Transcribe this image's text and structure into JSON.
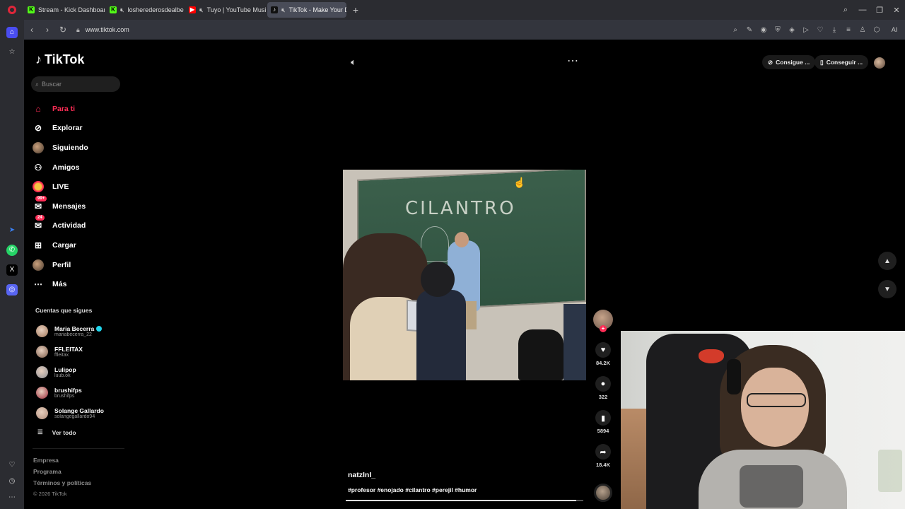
{
  "browser": {
    "tabs": [
      {
        "label": "Stream - Kick Dashboard",
        "fav_color": "#53fc18",
        "fav_glyph": "K",
        "muted": false,
        "active": false
      },
      {
        "label": "losherederosdealberdi",
        "fav_color": "#53fc18",
        "fav_glyph": "K",
        "muted": true,
        "active": false
      },
      {
        "label": "Tuyo | YouTube Music",
        "fav_color": "#ff0000",
        "fav_glyph": "▶",
        "muted": true,
        "active": false
      },
      {
        "label": "TikTok - Make Your Da",
        "fav_color": "#111111",
        "fav_glyph": "♪",
        "muted": true,
        "active": true
      }
    ],
    "url": "www.tiktok.com",
    "ai_label": "AI"
  },
  "tiktok": {
    "logo_text": "TikTok",
    "search_placeholder": "Buscar",
    "menu": [
      {
        "label": "Para ti",
        "icon": "home-icon",
        "active": true
      },
      {
        "label": "Explorar",
        "icon": "compass-icon",
        "active": false
      },
      {
        "label": "Siguiendo",
        "icon": "following-avatar",
        "active": false
      },
      {
        "label": "Amigos",
        "icon": "friends-icon",
        "active": false
      },
      {
        "label": "LIVE",
        "icon": "live-icon",
        "active": false
      },
      {
        "label": "Mensajes",
        "icon": "messages-icon",
        "active": false,
        "badge": "99+"
      },
      {
        "label": "Actividad",
        "icon": "activity-icon",
        "active": false,
        "badge": "24"
      },
      {
        "label": "Cargar",
        "icon": "upload-icon",
        "active": false
      },
      {
        "label": "Perfil",
        "icon": "profile-avatar",
        "active": false
      },
      {
        "label": "Más",
        "icon": "more-icon",
        "active": false
      }
    ],
    "following_title": "Cuentas que sigues",
    "following": [
      {
        "name": "Maria Becerra",
        "handle": "mariabecerra_22",
        "verified": true,
        "color": "#a0765a"
      },
      {
        "name": "FFLEITAX",
        "handle": "ffleitax",
        "verified": false,
        "color": "#7a5a48"
      },
      {
        "name": "Lulipop",
        "handle": "luub.ok",
        "verified": false,
        "color": "#8c8f95"
      },
      {
        "name": "brushifps",
        "handle": "brushifps",
        "verified": false,
        "color": "#9b2a3a"
      },
      {
        "name": "Solange Gallardo",
        "handle": "solangegallardo94",
        "verified": false,
        "color": "#b08c7a"
      }
    ],
    "see_all": "Ver todo",
    "footer": [
      "Empresa",
      "Programa",
      "Términos y políticas"
    ],
    "copyright": "© 2026 TikTok",
    "top_pills": [
      "Consigue ...",
      "Conseguir ..."
    ],
    "video": {
      "board_text": "CILANTRO",
      "author": "natzInI_",
      "tags": "#profesor #enojado #cilantro #perejil #humor",
      "progress": 0.97
    },
    "actions": [
      {
        "icon": "heart-icon",
        "count": "84.2K"
      },
      {
        "icon": "comment-icon",
        "count": "322"
      },
      {
        "icon": "bookmark-icon",
        "count": "5894"
      },
      {
        "icon": "share-icon",
        "count": "18.4K"
      }
    ]
  }
}
